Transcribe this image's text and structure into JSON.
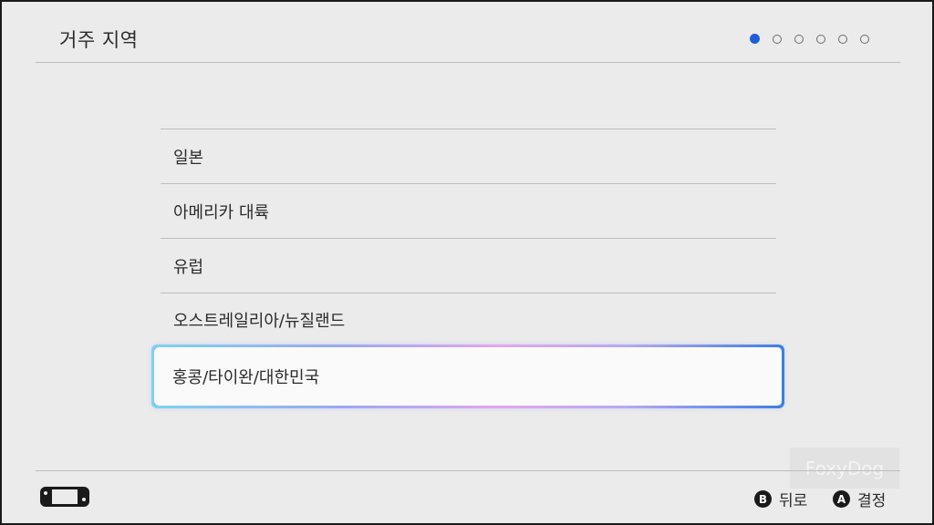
{
  "header": {
    "title": "거주 지역",
    "steps": {
      "total": 6,
      "current": 1
    }
  },
  "regions": [
    {
      "label": "일본",
      "selected": false
    },
    {
      "label": "아메리카 대륙",
      "selected": false
    },
    {
      "label": "유럽",
      "selected": false
    },
    {
      "label": "오스트레일리아/뉴질랜드",
      "selected": false
    },
    {
      "label": "홍콩/타이완/대한민국",
      "selected": true
    }
  ],
  "footer": {
    "back": {
      "button": "B",
      "label": "뒤로"
    },
    "confirm": {
      "button": "A",
      "label": "결정"
    },
    "device_icon": "console-icon"
  },
  "watermark": "FoxyDog",
  "colors": {
    "accent": "#1f5fd6",
    "background": "#ebebeb"
  }
}
